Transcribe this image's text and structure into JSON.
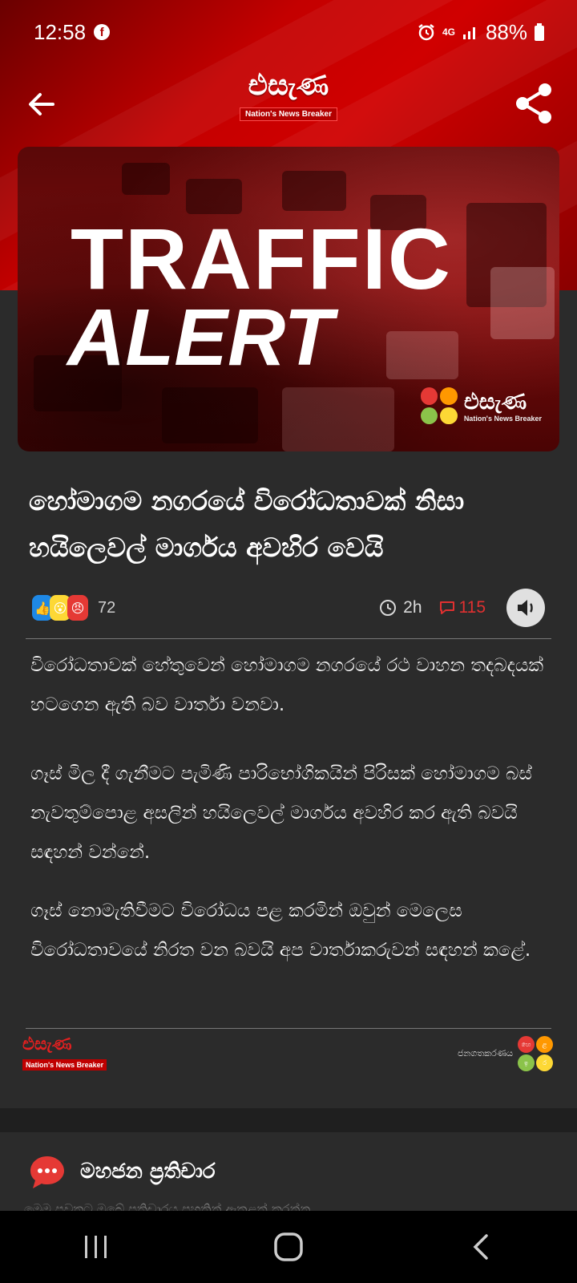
{
  "status_bar": {
    "time": "12:58",
    "network": "4G",
    "battery": "88%"
  },
  "app_bar": {
    "logo_text": "එසැණ",
    "logo_tagline": "Nation's News Breaker"
  },
  "banner": {
    "title": "TRAFFIC",
    "subtitle": "ALERT",
    "logo_text": "එසැණ",
    "logo_tagline": "Nation's News Breaker"
  },
  "article": {
    "headline": "හෝමාගම නගරයේ විරෝධතාවක් නිසා හයිලෙවල් මාර්ගය අවහිර වෙයි",
    "reaction_count": "72",
    "time_ago": "2h",
    "comment_count": "115",
    "paragraphs": [
      "විරෝධතාවක් හේතුවෙන් හෝමාගම නගරයේ රථ වාහන තදබදයක් හටගෙන ඇති බව වාර්තා වනවා.",
      "ගෑස් මිල දී ගැනීමට පැමිණි පාරිභෝගිකයින් පිරිසක් හෝමාගම බස් නැවතුම්පොළ අසලින් හයිලෙවල් මාර්ගය අවහිර කර ඇති බවයි සඳහන් වන්නේ.",
      "ගෑස් නොමැතිවීමට විරෝධය පළ කරමින් ඔවුන් මෙලෙස විරෝධතාවයේ නිරත වන  බවයි අප වාර්තාකරුවන් සඳහන් කළේ."
    ]
  },
  "footer": {
    "logo_text": "එසැණ",
    "logo_tagline": "Nation's News Breaker",
    "right_label": "ජනගතකරණය",
    "dots": [
      "හෙ",
      "ළ",
      "ඉ",
      "ර"
    ]
  },
  "comments_section": {
    "title": "මහජන ප්‍රතිචාර",
    "peek_text": "මෙම පුවතට ඔබේ ප්‍රතිචාරය පහතින් ඇතුළත් කරන්න"
  },
  "colors": {
    "brand_red": "#c40000",
    "background": "#2b2b2b",
    "comment_red": "#e03030"
  },
  "icons": [
    "back-arrow-icon",
    "share-icon",
    "clock-icon",
    "comment-icon",
    "speaker-icon",
    "chat-bubble-icon",
    "recents-icon",
    "home-icon",
    "back-nav-icon"
  ]
}
